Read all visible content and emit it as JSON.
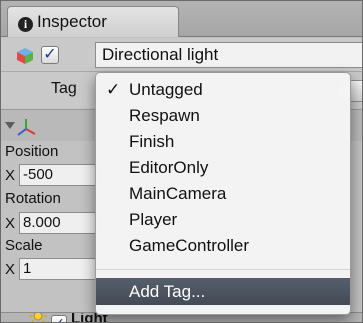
{
  "tab": {
    "title": "Inspector",
    "icon": "info-icon"
  },
  "object": {
    "active": true,
    "name": "Directional light"
  },
  "tag": {
    "label": "Tag"
  },
  "transform": {
    "position_label": "Position",
    "rotation_label": "Rotation",
    "scale_label": "Scale",
    "axis_x": "X",
    "position_x": "-500",
    "rotation_x": "8.000",
    "scale_x": "1"
  },
  "light": {
    "label": "Light",
    "enabled": true
  },
  "tag_menu": {
    "items": [
      {
        "label": "Untagged",
        "checked": true
      },
      {
        "label": "Respawn",
        "checked": false
      },
      {
        "label": "Finish",
        "checked": false
      },
      {
        "label": "EditorOnly",
        "checked": false
      },
      {
        "label": "MainCamera",
        "checked": false
      },
      {
        "label": "Player",
        "checked": false
      },
      {
        "label": "GameController",
        "checked": false
      }
    ],
    "check_mark": "✓",
    "add_tag": "Add Tag..."
  },
  "colors": {
    "highlight": "#4b5260",
    "check_blue": "#1b3a8e"
  }
}
